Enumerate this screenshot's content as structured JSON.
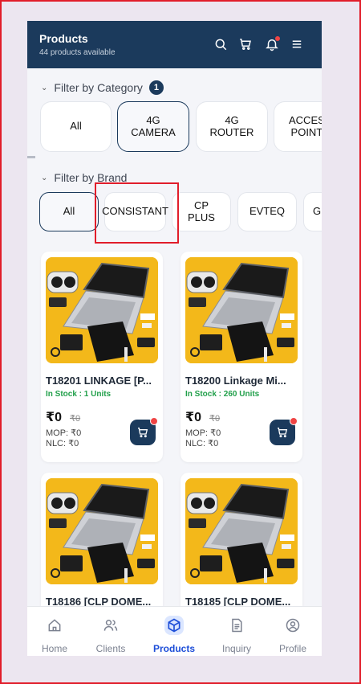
{
  "header": {
    "title": "Products",
    "subtitle": "44 products available"
  },
  "category_filter": {
    "label": "Filter by Category",
    "count": "1",
    "chips": [
      {
        "l1": "All",
        "l2": ""
      },
      {
        "l1": "4G",
        "l2": "CAMERA"
      },
      {
        "l1": "4G",
        "l2": "ROUTER"
      },
      {
        "l1": "ACCES",
        "l2": "POINT"
      }
    ]
  },
  "brand_filter": {
    "label": "Filter by Brand",
    "chips": [
      {
        "l1": "All",
        "l2": ""
      },
      {
        "l1": "CONSISTANT",
        "l2": ""
      },
      {
        "l1": "CP",
        "l2": "PLUS"
      },
      {
        "l1": "EVTEQ",
        "l2": ""
      },
      {
        "l1": "G",
        "l2": ""
      }
    ]
  },
  "products": [
    {
      "name": "T18201 LINKAGE [P...",
      "stock": "In Stock : 1 Units",
      "price": "₹0",
      "old_price": "₹0",
      "mop": "MOP: ₹0",
      "nlc": "NLC: ₹0"
    },
    {
      "name": "T18200 Linkage Mi...",
      "stock": "In Stock : 260 Units",
      "price": "₹0",
      "old_price": "₹0",
      "mop": "MOP: ₹0",
      "nlc": "NLC: ₹0"
    },
    {
      "name": "T18186 [CLP DOME...",
      "stock": "",
      "price": "",
      "old_price": "",
      "mop": "",
      "nlc": ""
    },
    {
      "name": "T18185 [CLP DOME...",
      "stock": "",
      "price": "",
      "old_price": "",
      "mop": "",
      "nlc": ""
    }
  ],
  "nav": {
    "home": "Home",
    "clients": "Clients",
    "products": "Products",
    "inquiry": "Inquiry",
    "profile": "Profile"
  },
  "colors": {
    "header": "#1b3a5c",
    "accent": "#1d4ed8",
    "stock": "#22a04b",
    "alert": "#ef4444"
  }
}
